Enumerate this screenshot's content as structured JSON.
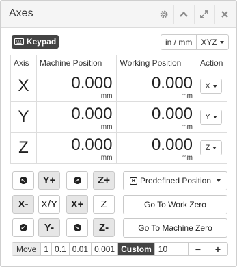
{
  "header": {
    "title": "Axes",
    "icons": [
      "gear-icon",
      "chevron-up-icon",
      "expand-icon",
      "close-icon"
    ]
  },
  "toolbar": {
    "keypad_label": "Keypad",
    "units_label": "in / mm",
    "axes_label": "XYZ"
  },
  "table": {
    "headers": [
      "Axis",
      "Machine Position",
      "Working Position",
      "Action"
    ],
    "rows": [
      {
        "axis": "X",
        "machine": "0.000",
        "working": "0.000",
        "unit": "mm",
        "action": "X"
      },
      {
        "axis": "Y",
        "machine": "0.000",
        "working": "0.000",
        "unit": "mm",
        "action": "Y"
      },
      {
        "axis": "Z",
        "machine": "0.000",
        "working": "0.000",
        "unit": "mm",
        "action": "Z"
      }
    ]
  },
  "jog": {
    "y_plus": "Y+",
    "z_plus": "Z+",
    "x_minus": "X-",
    "xy": "X/Y",
    "x_plus": "X+",
    "z": "Z",
    "y_minus": "Y-",
    "z_minus": "Z-"
  },
  "actions": {
    "predefined": "Predefined Position",
    "work_zero": "Go To Work Zero",
    "machine_zero": "Go To Machine Zero"
  },
  "step": {
    "label": "Move",
    "options": [
      "1",
      "0.1",
      "0.01",
      "0.001"
    ],
    "custom_label": "Custom",
    "custom_value": "10",
    "minus": "−",
    "plus": "+"
  }
}
